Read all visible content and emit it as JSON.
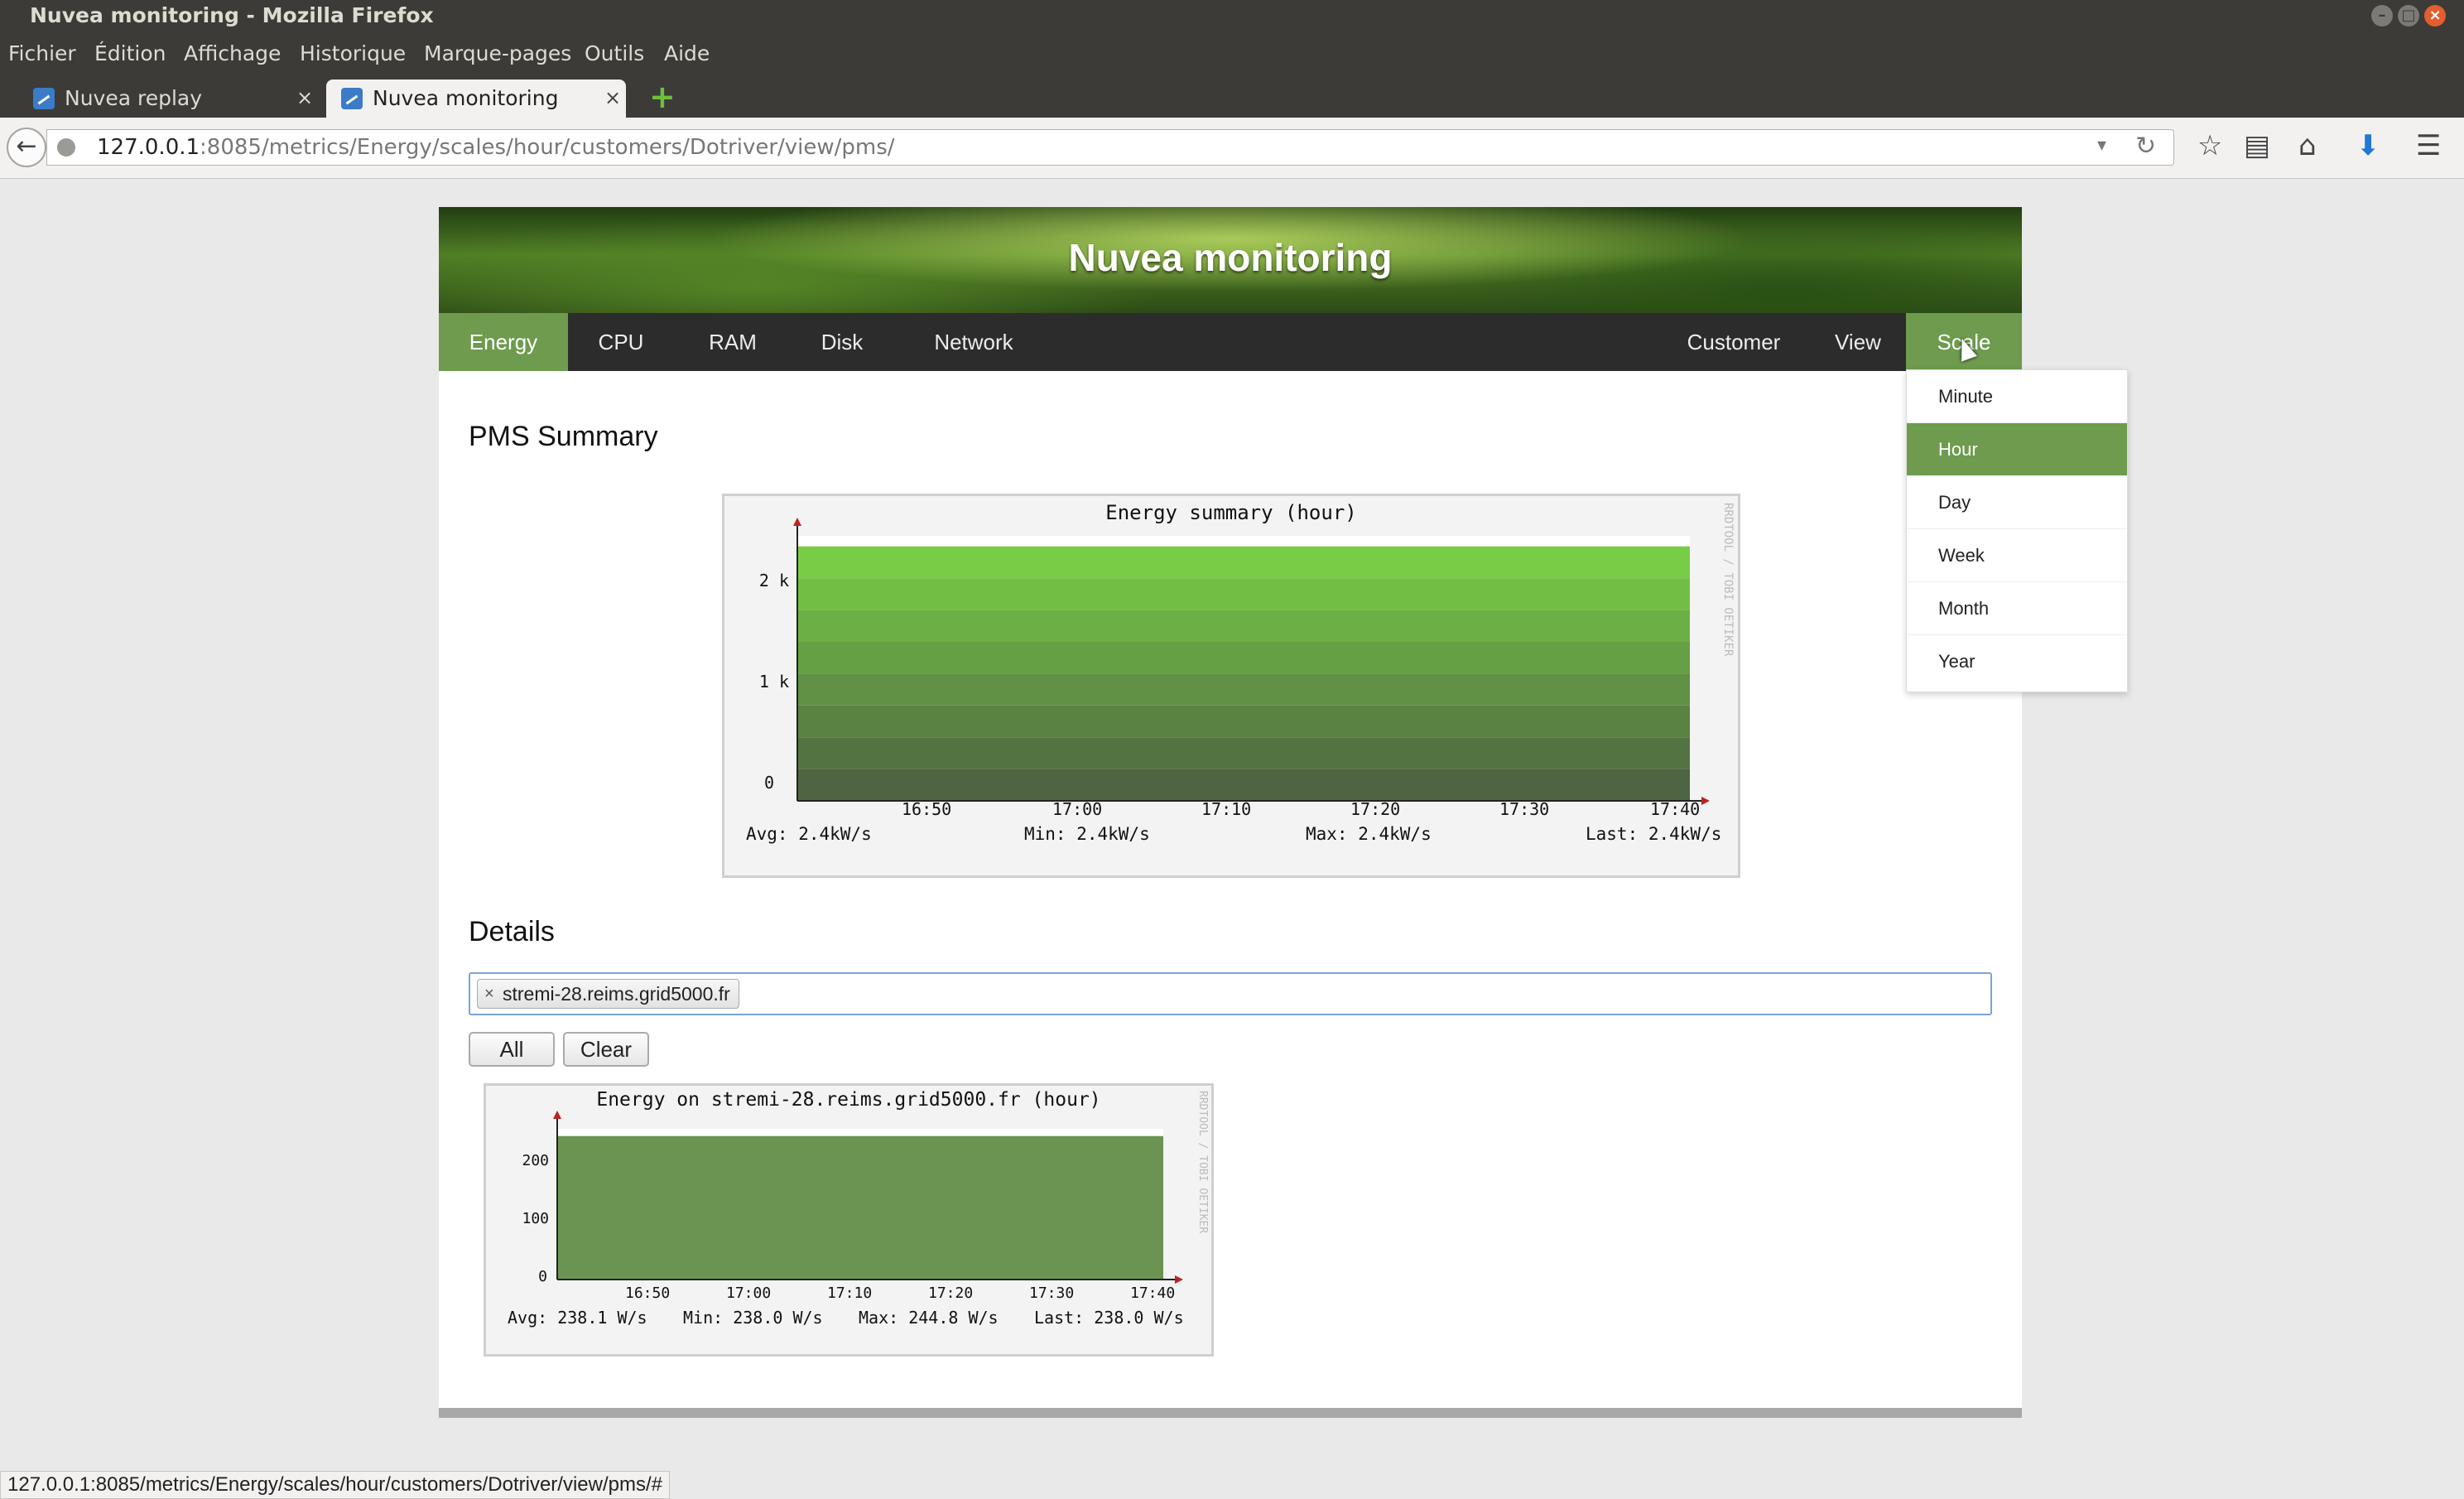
{
  "window": {
    "title": "Nuvea monitoring - Mozilla Firefox"
  },
  "menu": [
    "Fichier",
    "Édition",
    "Affichage",
    "Historique",
    "Marque-pages",
    "Outils",
    "Aide"
  ],
  "tabs": [
    {
      "label": "Nuvea replay",
      "active": false
    },
    {
      "label": "Nuvea monitoring",
      "active": true
    }
  ],
  "address": {
    "host": "127.0.0.1",
    "rest": ":8085/metrics/Energy/scales/hour/customers/Dotriver/view/pms/"
  },
  "site": {
    "title": "Nuvea monitoring",
    "nav_left": [
      "Energy",
      "CPU",
      "RAM",
      "Disk",
      "Network"
    ],
    "nav_right": [
      "Customer",
      "View",
      "Scale"
    ],
    "active_left": "Energy",
    "active_right": "Scale"
  },
  "scale_menu": {
    "items": [
      "Minute",
      "Hour",
      "Day",
      "Week",
      "Month",
      "Year"
    ],
    "selected": "Hour"
  },
  "summary": {
    "heading": "PMS Summary"
  },
  "details": {
    "heading": "Details",
    "tag": "stremi-28.reims.grid5000.fr",
    "all_label": "All",
    "clear_label": "Clear"
  },
  "statusbar": {
    "text": "127.0.0.1:8085/metrics/Energy/scales/hour/customers/Dotriver/view/pms/#"
  },
  "chart_data": [
    {
      "type": "area",
      "title": "Energy summary (hour)",
      "side_label": "RRDTOOL / TOBI OETIKER",
      "x_ticks": [
        "16:50",
        "17:00",
        "17:10",
        "17:20",
        "17:30",
        "17:40"
      ],
      "y_ticks": [
        "0",
        "1 k",
        "2 k"
      ],
      "ylim": [
        0,
        2500
      ],
      "layers": 8,
      "values": [
        2400,
        2400,
        2400,
        2400,
        2400,
        2400
      ],
      "legend": [
        "Avg: 2.4kW/s",
        "Min: 2.4kW/s",
        "Max: 2.4kW/s",
        "Last: 2.4kW/s"
      ]
    },
    {
      "type": "area",
      "title": "Energy on stremi-28.reims.grid5000.fr (hour)",
      "side_label": "RRDTOOL / TOBI OETIKER",
      "x_ticks": [
        "16:50",
        "17:00",
        "17:10",
        "17:20",
        "17:30",
        "17:40"
      ],
      "y_ticks": [
        "0",
        "100",
        "200"
      ],
      "ylim": [
        0,
        250
      ],
      "values": [
        238,
        238,
        238,
        238,
        238,
        238
      ],
      "legend": [
        "Avg: 238.1 W/s",
        "Min: 238.0 W/s",
        "Max: 244.8 W/s",
        "Last: 238.0 W/s"
      ]
    }
  ]
}
